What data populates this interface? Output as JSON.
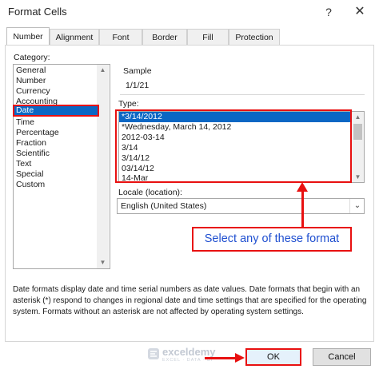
{
  "window": {
    "title": "Format Cells",
    "help_glyph": "?",
    "close_glyph": "✕"
  },
  "tabs": [
    {
      "label": "Number",
      "active": true
    },
    {
      "label": "Alignment",
      "active": false
    },
    {
      "label": "Font",
      "active": false
    },
    {
      "label": "Border",
      "active": false
    },
    {
      "label": "Fill",
      "active": false
    },
    {
      "label": "Protection",
      "active": false
    }
  ],
  "category": {
    "label": "Category:",
    "items": [
      "General",
      "Number",
      "Currency",
      "Accounting",
      "Date",
      "Time",
      "Percentage",
      "Fraction",
      "Scientific",
      "Text",
      "Special",
      "Custom"
    ],
    "selected": "Date"
  },
  "sample": {
    "label": "Sample",
    "value": "1/1/21"
  },
  "type": {
    "label": "Type:",
    "items": [
      "*3/14/2012",
      "*Wednesday, March 14, 2012",
      "2012-03-14",
      "3/14",
      "3/14/12",
      "03/14/12",
      "14-Mar"
    ],
    "selected": "*3/14/2012"
  },
  "locale": {
    "label": "Locale (location):",
    "value": "English (United States)"
  },
  "annotation": {
    "text": "Select any of these format"
  },
  "description": "Date formats display date and time serial numbers as date values.  Date formats that begin with an asterisk (*) respond to changes in regional date and time settings that are specified for the operating system. Formats without an asterisk are not affected by operating system settings.",
  "watermark": {
    "name": "exceldemy",
    "tagline": "EXCEL · DATA · BI"
  },
  "buttons": {
    "ok": "OK",
    "cancel": "Cancel"
  },
  "colors": {
    "selection": "#0b67c4",
    "annotation_red": "#e81010",
    "annotation_text": "#1f4fd0"
  }
}
